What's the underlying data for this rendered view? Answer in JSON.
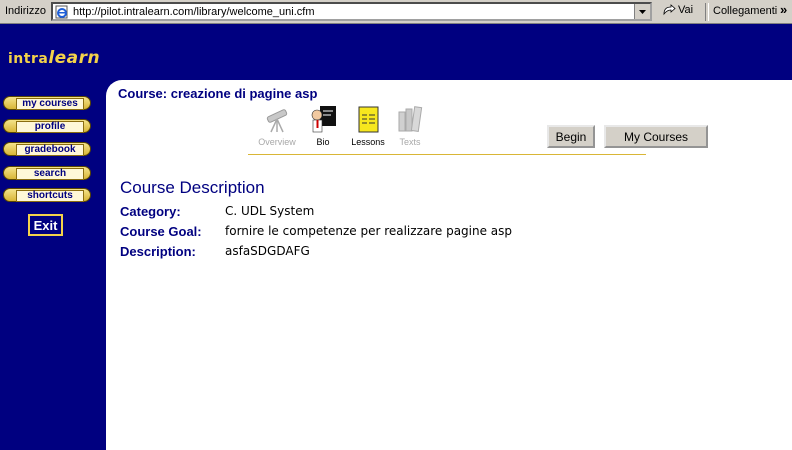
{
  "browser": {
    "address_label": "Indirizzo",
    "url": "http://pilot.intralearn.com/library/welcome_uni.cfm",
    "go_label": "Vai",
    "links_label": "Collegamenti",
    "links_more": "»",
    "icons": {
      "page": "ie-page-icon",
      "go": "go-arrow-icon",
      "dropdown": "dropdown-arrow-icon"
    }
  },
  "logo": {
    "prefix": "intra",
    "suffix": "learn"
  },
  "sidebar": {
    "items": [
      {
        "label": "my courses"
      },
      {
        "label": "profile"
      },
      {
        "label": "gradebook"
      },
      {
        "label": "search"
      },
      {
        "label": "shortcuts"
      }
    ],
    "exit_label": "Exit"
  },
  "course": {
    "title": "Course: creazione di pagine asp",
    "toolbar": [
      {
        "label": "Overview",
        "icon": "telescope-icon",
        "state": "disabled"
      },
      {
        "label": "Bio",
        "icon": "teacher-icon",
        "state": "enabled"
      },
      {
        "label": "Lessons",
        "icon": "notepad-icon",
        "state": "enabled"
      },
      {
        "label": "Texts",
        "icon": "books-icon",
        "state": "disabled"
      }
    ],
    "buttons": {
      "begin": "Begin",
      "my_courses": "My Courses"
    },
    "heading": "Course Description",
    "fields": [
      {
        "key": "Category:",
        "value": "C. UDL System"
      },
      {
        "key": "Course Goal:",
        "value": "fornire le competenze per realizzare pagine asp"
      },
      {
        "key": "Description:",
        "value": "asfaSDGDAFG"
      }
    ]
  },
  "colors": {
    "navy": "#000080",
    "gold": "#f3d24a",
    "gray": "#d4d0c8"
  }
}
